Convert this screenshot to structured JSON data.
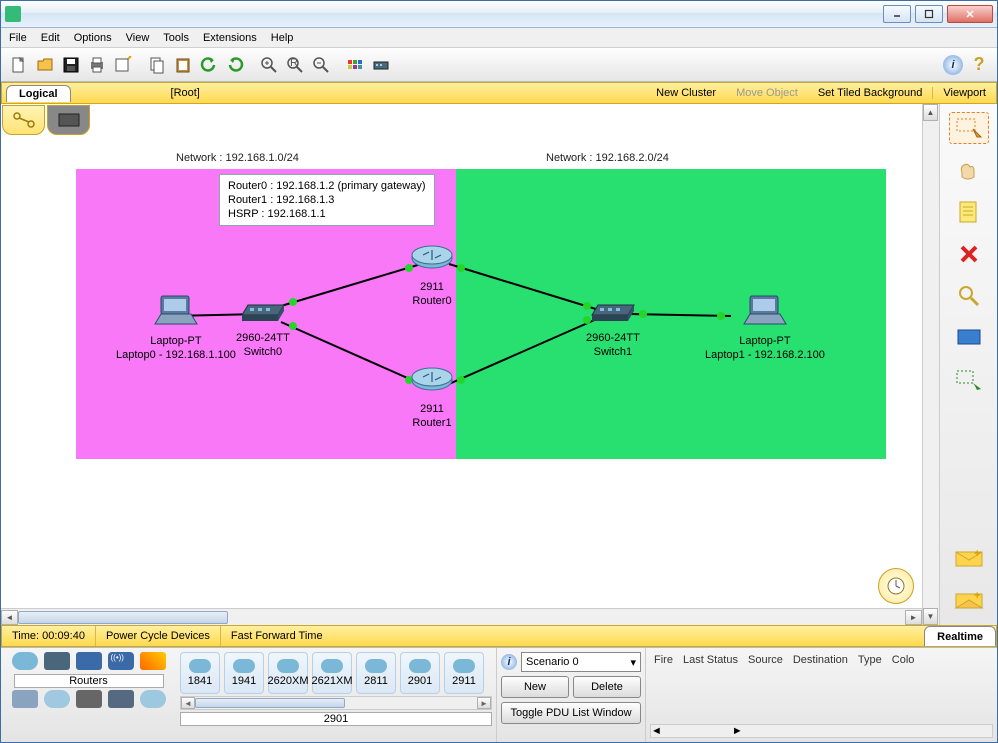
{
  "window": {
    "minimize": "_",
    "maximize": "□",
    "close": "X"
  },
  "menu": {
    "file": "File",
    "edit": "Edit",
    "options": "Options",
    "view": "View",
    "tools": "Tools",
    "extensions": "Extensions",
    "help": "Help"
  },
  "nav": {
    "logical": "Logical",
    "root": "[Root]",
    "new_cluster": "New Cluster",
    "move_object": "Move Object",
    "set_tiled_bg": "Set Tiled Background",
    "viewport": "Viewport"
  },
  "topology": {
    "net1_label": "Network : 192.168.1.0/24",
    "net2_label": "Network : 192.168.2.0/24",
    "note_line1": "Router0 : 192.168.1.2 (primary gateway)",
    "note_line2": "Router1 : 192.168.1.3",
    "note_line3": "HSRP : 192.168.1.1",
    "laptop0_type": "Laptop-PT",
    "laptop0_name": "Laptop0 - 192.168.1.100",
    "switch0_type": "2960-24TT",
    "switch0_name": "Switch0",
    "router0_type": "2911",
    "router0_name": "Router0",
    "router1_type": "2911",
    "router1_name": "Router1",
    "switch1_type": "2960-24TT",
    "switch1_name": "Switch1",
    "laptop1_type": "Laptop-PT",
    "laptop1_name": "Laptop1 - 192.168.2.100"
  },
  "status": {
    "time_label": "Time: 00:09:40",
    "power_cycle": "Power Cycle Devices",
    "fast_forward": "Fast Forward Time",
    "realtime": "Realtime"
  },
  "devcat": {
    "label": "Routers"
  },
  "models": {
    "m0": "1841",
    "m1": "1941",
    "m2": "2620XM",
    "m3": "2621XM",
    "m4": "2811",
    "m5": "2901",
    "m6": "2911",
    "selected": "2901"
  },
  "scenario": {
    "selected": "Scenario 0",
    "new": "New",
    "delete": "Delete",
    "toggle": "Toggle PDU List Window"
  },
  "pdu": {
    "fire": "Fire",
    "last_status": "Last Status",
    "source": "Source",
    "destination": "Destination",
    "type": "Type",
    "color": "Colo"
  }
}
